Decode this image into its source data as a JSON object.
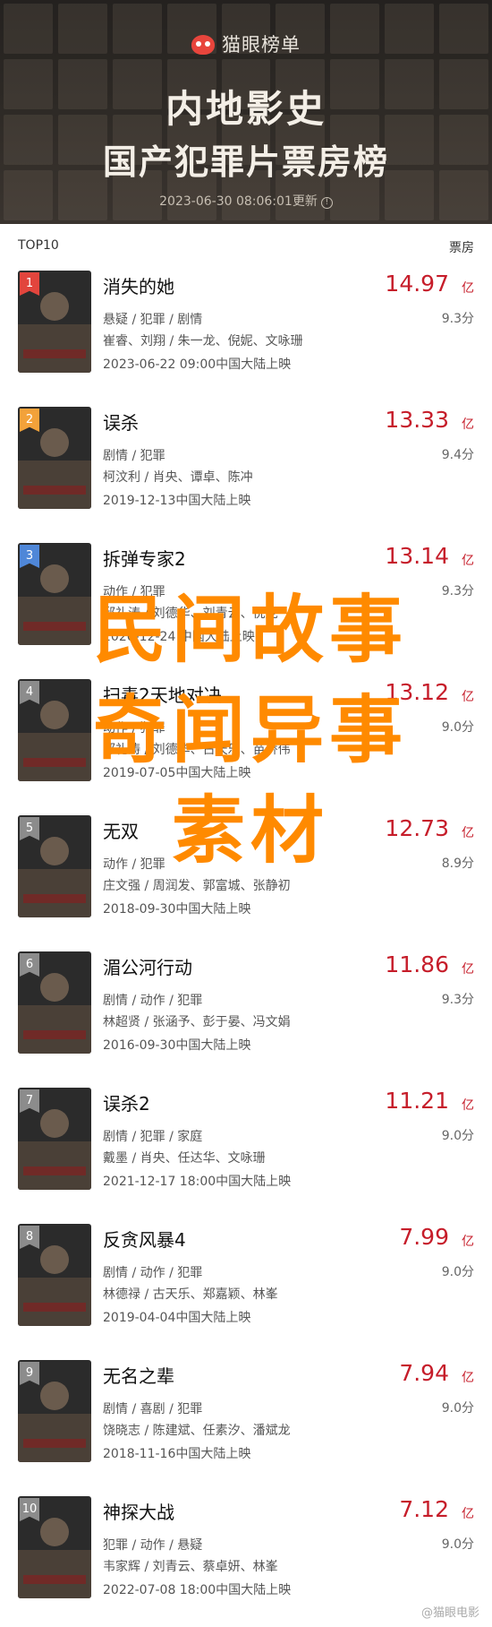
{
  "header": {
    "brand": "猫眼榜单",
    "title1": "内地影史",
    "title2": "国产犯罪片票房榜",
    "timestamp": "2023-06-30 08:06:01更新"
  },
  "columns": {
    "left": "TOP10",
    "right": "票房"
  },
  "movies": [
    {
      "rank": "1",
      "title": "消失的她",
      "box": "14.97",
      "unit": "亿",
      "genre": "悬疑 / 犯罪 / 剧情",
      "score": "9.3分",
      "cast": "崔睿、刘翔 / 朱一龙、倪妮、文咏珊",
      "date": "2023-06-22 09:00中国大陆上映",
      "rankColor": "#e2453d"
    },
    {
      "rank": "2",
      "title": "误杀",
      "box": "13.33",
      "unit": "亿",
      "genre": "剧情 / 犯罪",
      "score": "9.4分",
      "cast": "柯汶利 / 肖央、谭卓、陈冲",
      "date": "2019-12-13中国大陆上映",
      "rankColor": "#f3a23a"
    },
    {
      "rank": "3",
      "title": "拆弹专家2",
      "box": "13.14",
      "unit": "亿",
      "genre": "动作 / 犯罪",
      "score": "9.3分",
      "cast": "邱礼涛 / 刘德华、刘青云、倪妮",
      "date": "2020-12-24 中国大陆上映",
      "rankColor": "#4f87d8"
    },
    {
      "rank": "4",
      "title": "扫毒2天地对决",
      "box": "13.12",
      "unit": "亿",
      "genre": "动作 / 犯罪",
      "score": "9.0分",
      "cast": "邱礼涛 / 刘德华、古天乐、苗侨伟",
      "date": "2019-07-05中国大陆上映",
      "rankColor": "#8c8c8c"
    },
    {
      "rank": "5",
      "title": "无双",
      "box": "12.73",
      "unit": "亿",
      "genre": "动作 / 犯罪",
      "score": "8.9分",
      "cast": "庄文强 / 周润发、郭富城、张静初",
      "date": "2018-09-30中国大陆上映",
      "rankColor": "#8c8c8c"
    },
    {
      "rank": "6",
      "title": "湄公河行动",
      "box": "11.86",
      "unit": "亿",
      "genre": "剧情 / 动作 / 犯罪",
      "score": "9.3分",
      "cast": "林超贤 / 张涵予、彭于晏、冯文娟",
      "date": "2016-09-30中国大陆上映",
      "rankColor": "#8c8c8c"
    },
    {
      "rank": "7",
      "title": "误杀2",
      "box": "11.21",
      "unit": "亿",
      "genre": "剧情 / 犯罪 / 家庭",
      "score": "9.0分",
      "cast": "戴墨 / 肖央、任达华、文咏珊",
      "date": "2021-12-17 18:00中国大陆上映",
      "rankColor": "#8c8c8c"
    },
    {
      "rank": "8",
      "title": "反贪风暴4",
      "box": "7.99",
      "unit": "亿",
      "genre": "剧情 / 动作 / 犯罪",
      "score": "9.0分",
      "cast": "林德禄 / 古天乐、郑嘉颖、林峯",
      "date": "2019-04-04中国大陆上映",
      "rankColor": "#8c8c8c"
    },
    {
      "rank": "9",
      "title": "无名之辈",
      "box": "7.94",
      "unit": "亿",
      "genre": "剧情 / 喜剧 / 犯罪",
      "score": "9.0分",
      "cast": "饶晓志 / 陈建斌、任素汐、潘斌龙",
      "date": "2018-11-16中国大陆上映",
      "rankColor": "#8c8c8c"
    },
    {
      "rank": "10",
      "title": "神探大战",
      "box": "7.12",
      "unit": "亿",
      "genre": "犯罪 / 动作 / 悬疑",
      "score": "9.0分",
      "cast": "韦家辉 / 刘青云、蔡卓妍、林峯",
      "date": "2022-07-08 18:00中国大陆上映",
      "rankColor": "#8c8c8c"
    }
  ],
  "overlay_text": "民间故事奇闻异事素材",
  "watermark": "@猫眼电影"
}
